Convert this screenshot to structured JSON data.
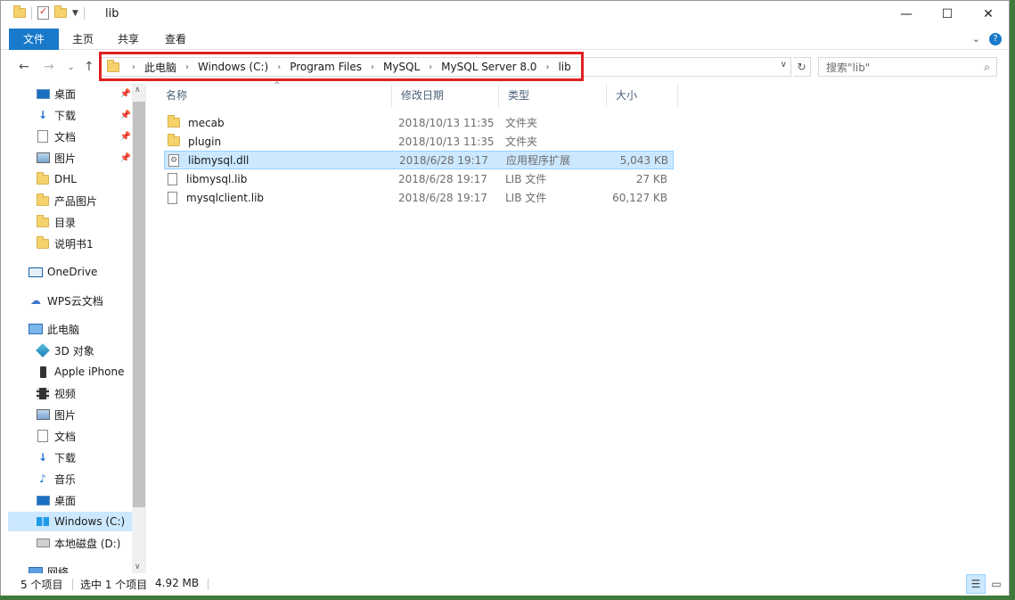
{
  "window": {
    "title": "lib",
    "controls": {
      "minimize": "—",
      "maximize": "☐",
      "close": "✕"
    }
  },
  "ribbon": {
    "tabs": [
      "文件",
      "主页",
      "共享",
      "查看"
    ]
  },
  "address": {
    "crumbs": [
      "此电脑",
      "Windows (C:)",
      "Program Files",
      "MySQL",
      "MySQL Server 8.0",
      "lib"
    ]
  },
  "search": {
    "placeholder": "搜索\"lib\""
  },
  "sidebar": {
    "items": [
      {
        "label": "桌面",
        "icon": "desktop-icon",
        "pinned": true
      },
      {
        "label": "下载",
        "icon": "download-icon",
        "pinned": true
      },
      {
        "label": "文档",
        "icon": "document-icon",
        "pinned": true
      },
      {
        "label": "图片",
        "icon": "pictures-icon",
        "pinned": true
      },
      {
        "label": "DHL",
        "icon": "folder-icon",
        "pinned": false
      },
      {
        "label": "产品图片",
        "icon": "folder-icon",
        "pinned": false
      },
      {
        "label": "目录",
        "icon": "folder-icon",
        "pinned": false
      },
      {
        "label": "说明书1",
        "icon": "folder-icon",
        "pinned": false
      },
      {
        "label": "OneDrive",
        "icon": "onedrive-icon",
        "pinned": false
      },
      {
        "label": "WPS云文档",
        "icon": "cloud-icon",
        "pinned": false
      },
      {
        "label": "此电脑",
        "icon": "computer-icon",
        "pinned": false
      },
      {
        "label": "3D 对象",
        "icon": "3d-objects-icon",
        "pinned": false
      },
      {
        "label": "Apple iPhone",
        "icon": "phone-icon",
        "pinned": false
      },
      {
        "label": "视频",
        "icon": "video-icon",
        "pinned": false
      },
      {
        "label": "图片",
        "icon": "pictures-icon",
        "pinned": false
      },
      {
        "label": "文档",
        "icon": "document-icon",
        "pinned": false
      },
      {
        "label": "下载",
        "icon": "download-icon",
        "pinned": false
      },
      {
        "label": "音乐",
        "icon": "music-icon",
        "pinned": false
      },
      {
        "label": "桌面",
        "icon": "desktop-icon",
        "pinned": false
      },
      {
        "label": "Windows (C:)",
        "icon": "windows-drive-icon",
        "pinned": false,
        "selected": true
      },
      {
        "label": "本地磁盘 (D:)",
        "icon": "drive-icon",
        "pinned": false
      },
      {
        "label": "网络",
        "icon": "network-icon",
        "pinned": false
      }
    ]
  },
  "columns": [
    "名称",
    "修改日期",
    "类型",
    "大小"
  ],
  "files": [
    {
      "name": "mecab",
      "date": "2018/10/13 11:35",
      "type": "文件夹",
      "size": "",
      "icon": "folder-icon"
    },
    {
      "name": "plugin",
      "date": "2018/10/13 11:35",
      "type": "文件夹",
      "size": "",
      "icon": "folder-icon"
    },
    {
      "name": "libmysql.dll",
      "date": "2018/6/28 19:17",
      "type": "应用程序扩展",
      "size": "5,043 KB",
      "icon": "dll-file-icon",
      "selected": true
    },
    {
      "name": "libmysql.lib",
      "date": "2018/6/28 19:17",
      "type": "LIB 文件",
      "size": "27 KB",
      "icon": "file-icon"
    },
    {
      "name": "mysqlclient.lib",
      "date": "2018/6/28 19:17",
      "type": "LIB 文件",
      "size": "60,127 KB",
      "icon": "file-icon"
    }
  ],
  "status": {
    "count": "5 个项目",
    "selection": "选中 1 个项目",
    "selection_size": "4.92 MB"
  }
}
